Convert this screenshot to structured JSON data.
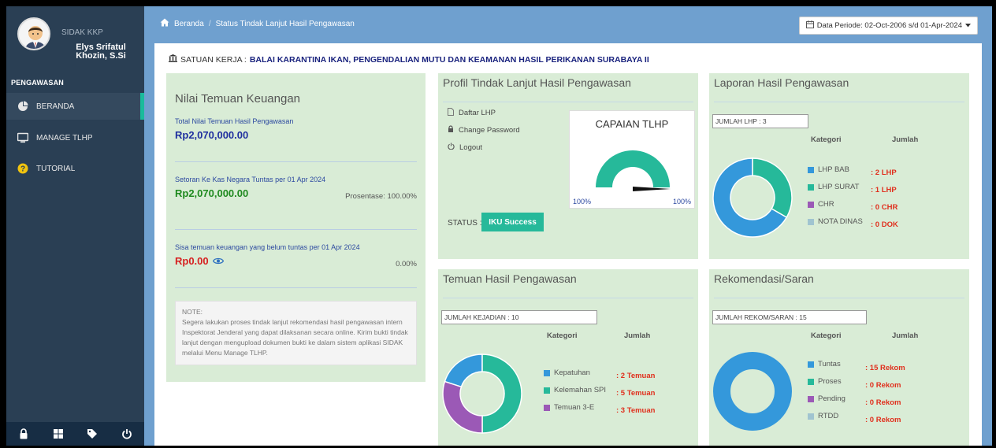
{
  "app": {
    "name": "SIDAK KKP"
  },
  "user": {
    "name": "Elys Srifatul Khozin, S.Si"
  },
  "sidebar": {
    "section": "PENGAWASAN",
    "items": [
      {
        "label": "BERANDA",
        "icon": "pie-chart-icon"
      },
      {
        "label": "MANAGE TLHP",
        "icon": "monitor-icon"
      },
      {
        "label": "TUTORIAL",
        "icon": "question-circle-icon"
      }
    ],
    "footer_icons": [
      "lock-icon",
      "grid-icon",
      "tag-icon",
      "power-icon"
    ]
  },
  "breadcrumb": {
    "home": "Beranda",
    "sep": "/",
    "current": "Status Tindak Lanjut Hasil Pengawasan"
  },
  "date_filter": {
    "label": "Data Periode: 02-Oct-2006 s/d 01-Apr-2024"
  },
  "satuan": {
    "label": "SATUAN KERJA :",
    "value": "BALAI KARANTINA IKAN, PENGENDALIAN MUTU DAN KEAMANAN HASIL PERIKANAN SURABAYA II"
  },
  "keuangan": {
    "title": "Nilai Temuan Keuangan",
    "total_label": "Total Nilai Temuan Hasil Pengawasan",
    "total_value": "Rp2,070,000.00",
    "setoran_label": "Setoran Ke Kas Negara Tuntas per 01 Apr 2024",
    "setoran_value": "Rp2,070,000.00",
    "setoran_pct": "Prosentase: 100.00%",
    "sisa_label": "Sisa temuan keuangan yang belum tuntas per 01 Apr 2024",
    "sisa_value": "Rp0.00",
    "sisa_pct": "0.00%",
    "note": "NOTE:\nSegera lakukan proses tindak lanjut rekomendasi hasil pengawasan intern Inspektorat Jenderal yang dapat dilaksanan secara online. Kirim bukti tindak lanjut dengan mengupload dokumen bukti ke dalam sistem aplikasi SIDAK melalui Menu Manage TLHP."
  },
  "profil": {
    "title": "Profil Tindak Lanjut Hasil Pengawasan",
    "links": [
      {
        "label": "Daftar LHP",
        "icon": "file-icon"
      },
      {
        "label": "Change Password",
        "icon": "lock-icon"
      },
      {
        "label": "Logout",
        "icon": "power-icon"
      }
    ],
    "gauge_title": "CAPAIAN TLHP",
    "gauge_value": 100,
    "gauge_min": "100%",
    "gauge_max": "100%",
    "status_label": "STATUS :",
    "status_badge": "IKU Success"
  },
  "laporan": {
    "title": "Laporan Hasil Pengawasan",
    "count": "JUMLAH LHP : 3",
    "col_kategori": "Kategori",
    "col_jumlah": "Jumlah",
    "items": [
      {
        "label": "LHP BAB",
        "value": ": 2 LHP",
        "count": 2,
        "color": "#3498db"
      },
      {
        "label": "LHP SURAT",
        "value": ": 1 LHP",
        "count": 1,
        "color": "#26b99a"
      },
      {
        "label": "CHR",
        "value": ": 0 CHR",
        "count": 0,
        "color": "#9b59b6"
      },
      {
        "label": "NOTA DINAS",
        "value": ": 0 DOK",
        "count": 0,
        "color": "#a0c4d0"
      }
    ]
  },
  "temuan": {
    "title": "Temuan Hasil Pengawasan",
    "count": "JUMLAH KEJADIAN : 10",
    "col_kategori": "Kategori",
    "col_jumlah": "Jumlah",
    "items": [
      {
        "label": "Kepatuhan",
        "value": ": 2 Temuan",
        "count": 2,
        "color": "#3498db"
      },
      {
        "label": "Kelemahan SPI",
        "value": ": 5 Temuan",
        "count": 5,
        "color": "#26b99a"
      },
      {
        "label": "Temuan 3-E",
        "value": ": 3 Temuan",
        "count": 3,
        "color": "#9b59b6"
      }
    ]
  },
  "rekomendasi": {
    "title": "Rekomendasi/Saran",
    "count": "JUMLAH REKOM/SARAN : 15",
    "col_kategori": "Kategori",
    "col_jumlah": "Jumlah",
    "items": [
      {
        "label": "Tuntas",
        "value": ": 15 Rekom",
        "count": 15,
        "color": "#3498db"
      },
      {
        "label": "Proses",
        "value": ": 0 Rekom",
        "count": 0,
        "color": "#26b99a"
      },
      {
        "label": "Pending",
        "value": ": 0 Rekom",
        "count": 0,
        "color": "#9b59b6"
      },
      {
        "label": "RTDD",
        "value": ": 0 Rekom",
        "count": 0,
        "color": "#a0c4d0"
      }
    ]
  }
}
